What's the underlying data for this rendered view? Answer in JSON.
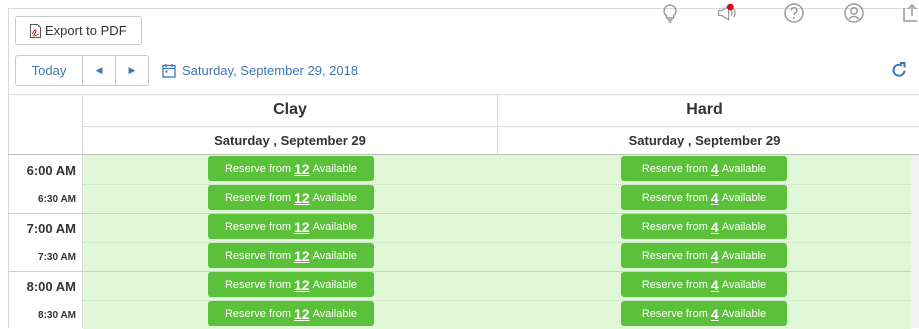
{
  "toolbar": {
    "export_label": "Export to PDF",
    "today_label": "Today",
    "prev_icon": "◀",
    "next_icon": "▶",
    "date_label": "Saturday, September 29, 2018"
  },
  "top_icons": [
    "lightbulb-icon",
    "megaphone-icon",
    "help-icon",
    "user-icon",
    "export-icon"
  ],
  "colors": {
    "reserve_button": "#5cc13a",
    "slot_background": "#e0f7d8",
    "link_blue": "#3c78b4",
    "notification_dot": "#e0001b"
  },
  "courts": [
    {
      "name": "Clay",
      "date": "Saturday , September 29"
    },
    {
      "name": "Hard",
      "date": "Saturday , September 29"
    }
  ],
  "slots": [
    {
      "time": "6:00 AM",
      "kind": "hour",
      "clay": {
        "prefix": "Reserve from",
        "count": "12",
        "suffix": "Available"
      },
      "hard": {
        "prefix": "Reserve from",
        "count": "4",
        "suffix": "Available"
      }
    },
    {
      "time": "6:30 AM",
      "kind": "half",
      "clay": {
        "prefix": "Reserve from",
        "count": "12",
        "suffix": "Available"
      },
      "hard": {
        "prefix": "Reserve from",
        "count": "4",
        "suffix": "Available"
      }
    },
    {
      "time": "7:00 AM",
      "kind": "hour",
      "clay": {
        "prefix": "Reserve from",
        "count": "12",
        "suffix": "Available"
      },
      "hard": {
        "prefix": "Reserve from",
        "count": "4",
        "suffix": "Available"
      }
    },
    {
      "time": "7:30 AM",
      "kind": "half",
      "clay": {
        "prefix": "Reserve from",
        "count": "12",
        "suffix": "Available"
      },
      "hard": {
        "prefix": "Reserve from",
        "count": "4",
        "suffix": "Available"
      }
    },
    {
      "time": "8:00 AM",
      "kind": "hour",
      "clay": {
        "prefix": "Reserve from",
        "count": "12",
        "suffix": "Available"
      },
      "hard": {
        "prefix": "Reserve from",
        "count": "4",
        "suffix": "Available"
      }
    },
    {
      "time": "8:30 AM",
      "kind": "half",
      "clay": {
        "prefix": "Reserve from",
        "count": "12",
        "suffix": "Available"
      },
      "hard": {
        "prefix": "Reserve from",
        "count": "4",
        "suffix": "Available"
      }
    }
  ]
}
